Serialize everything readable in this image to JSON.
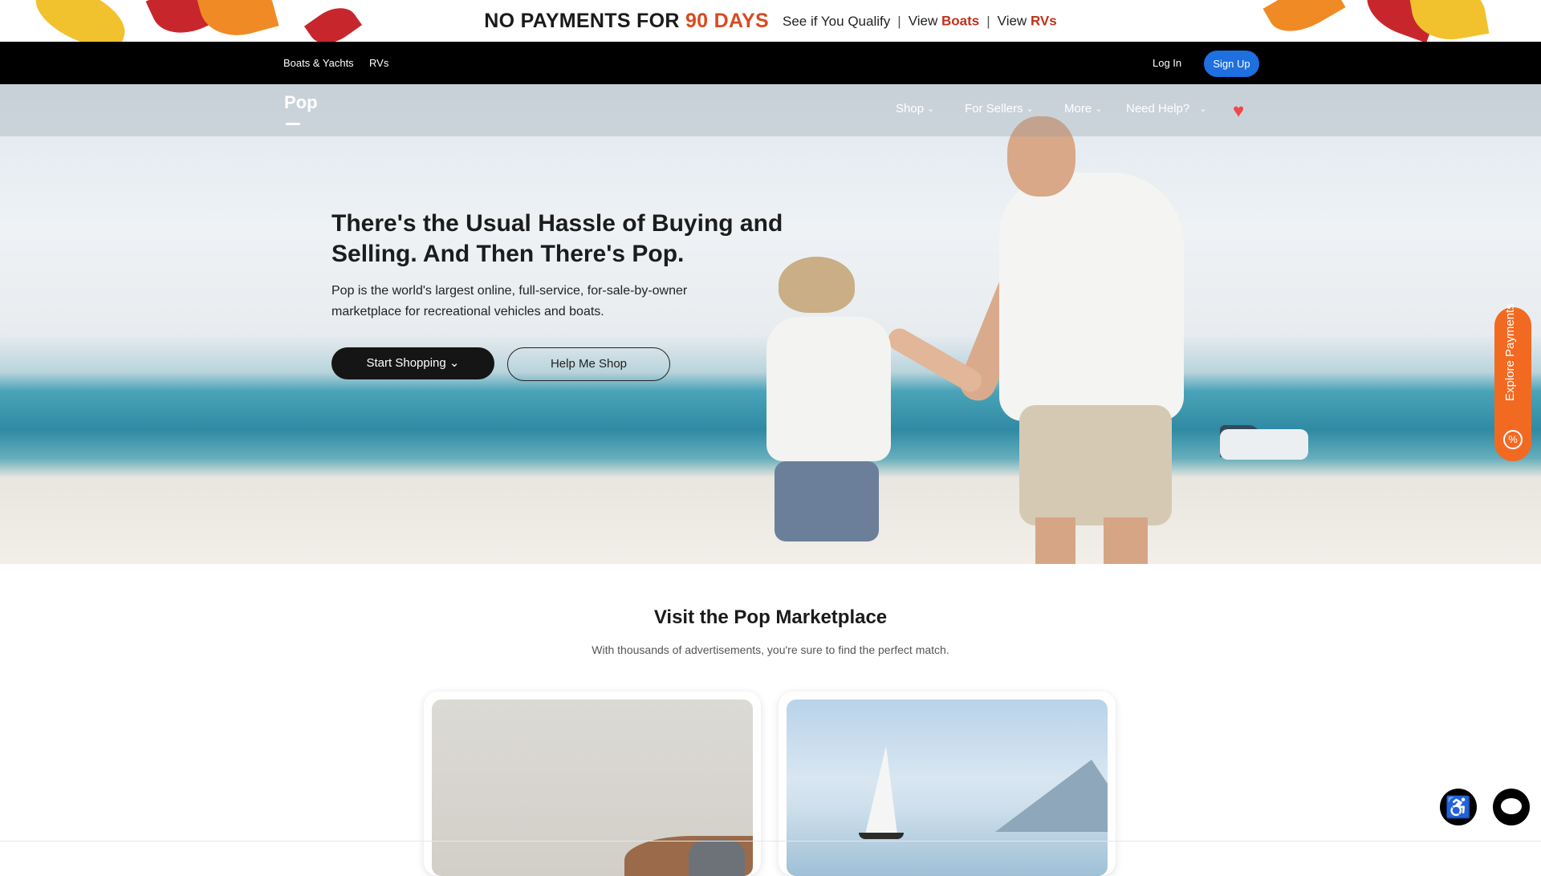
{
  "promo": {
    "headline_prefix": "NO PAYMENTS FOR",
    "headline_accent": "90 DAYS",
    "qualify_link": "See if You Qualify",
    "separator": "|",
    "view_label": "View",
    "boats_link": "Boats",
    "rvs_link": "RVs"
  },
  "topbar": {
    "links": [
      "Boats & Yachts",
      "RVs"
    ],
    "login": "Log In",
    "signup": "Sign Up"
  },
  "nav": {
    "logo": "Pop",
    "items": [
      "Shop",
      "For Sellers",
      "More",
      "Need Help?"
    ],
    "chevron": "⌄",
    "heart_icon": "♥"
  },
  "hero": {
    "title": "There's the Usual Hassle of Buying and Selling. And Then There's Pop.",
    "subtitle": "Pop is the world's largest online, full-service, for-sale-by-owner marketplace for recreational vehicles and boats.",
    "primary_button": "Start Shopping ⌄",
    "secondary_button": "Help Me Shop"
  },
  "explore": {
    "label": "Explore Payments",
    "icon": "%"
  },
  "marketplace": {
    "title": "Visit the Pop Marketplace",
    "subtitle": "With thousands of advertisements, you're sure to find the perfect match."
  },
  "floating": {
    "accessibility_icon": "♿"
  },
  "colors": {
    "accent_orange": "#f26a22",
    "promo_accent": "#d94a1e",
    "signup_blue": "#1e6fe0",
    "heart_red": "#f0464e"
  }
}
